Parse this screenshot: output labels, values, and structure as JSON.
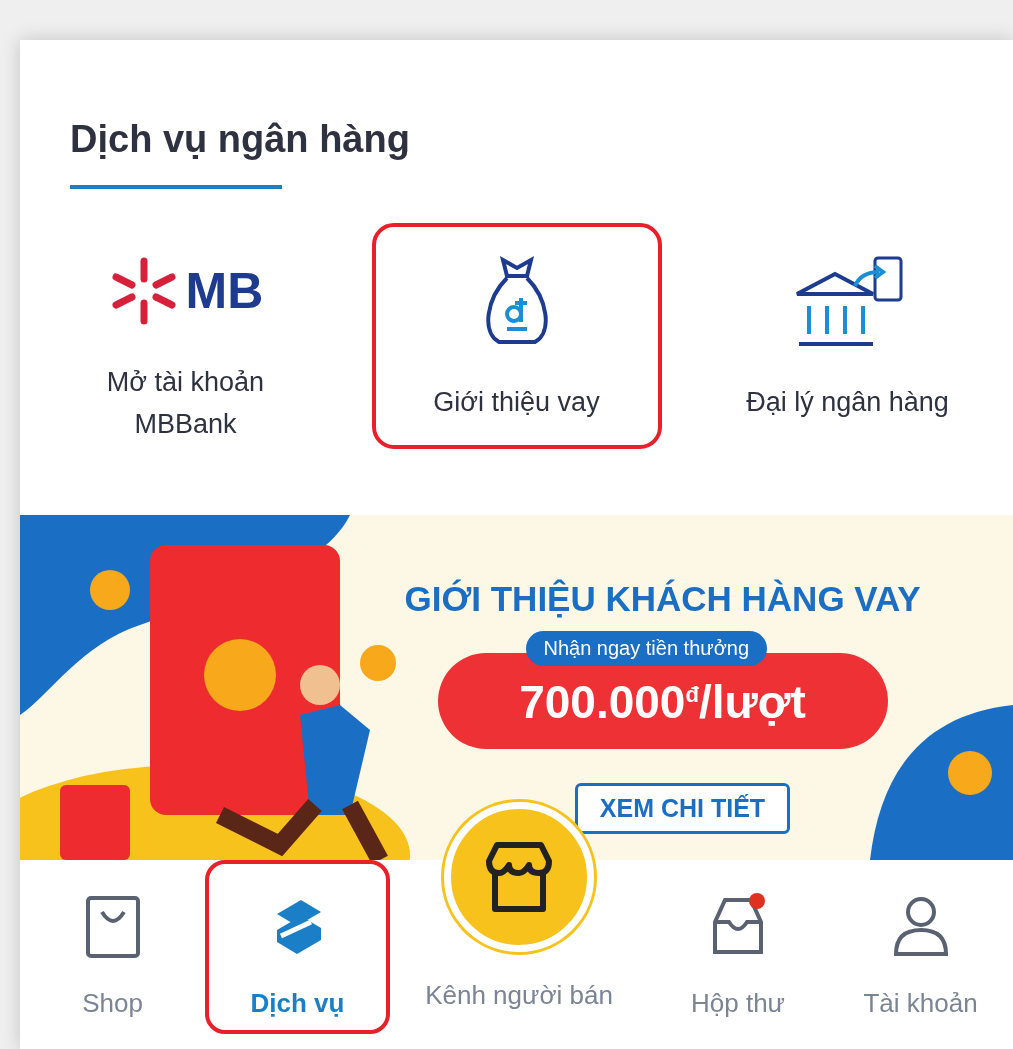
{
  "section": {
    "title": "Dịch vụ ngân hàng"
  },
  "services": [
    {
      "kind": "mb",
      "logo_text": "MB",
      "label": "Mở tài khoản\nMBBank",
      "highlighted": false
    },
    {
      "kind": "loan",
      "label": "Giới thiệu vay",
      "highlighted": true
    },
    {
      "kind": "agent",
      "label": "Đại lý ngân hàng",
      "highlighted": false
    }
  ],
  "banner": {
    "headline": "GIỚI THIỆU KHÁCH HÀNG VAY",
    "tag": "Nhận ngay tiền thưởng",
    "amount": "700.000$^{đ}$/lượt",
    "button": "XEM CHI TIẾT"
  },
  "nav": [
    {
      "kind": "shop",
      "label": "Shop",
      "selected": false,
      "highlighted": false,
      "badge": false
    },
    {
      "kind": "services",
      "label": "Dịch vụ",
      "selected": true,
      "highlighted": true,
      "badge": false
    },
    {
      "kind": "seller",
      "label": "Kênh người bán",
      "selected": false,
      "highlighted": false,
      "badge": false
    },
    {
      "kind": "inbox",
      "label": "Hộp thư",
      "selected": false,
      "highlighted": false,
      "badge": true
    },
    {
      "kind": "account",
      "label": "Tài khoản",
      "selected": false,
      "highlighted": false,
      "badge": false
    }
  ]
}
